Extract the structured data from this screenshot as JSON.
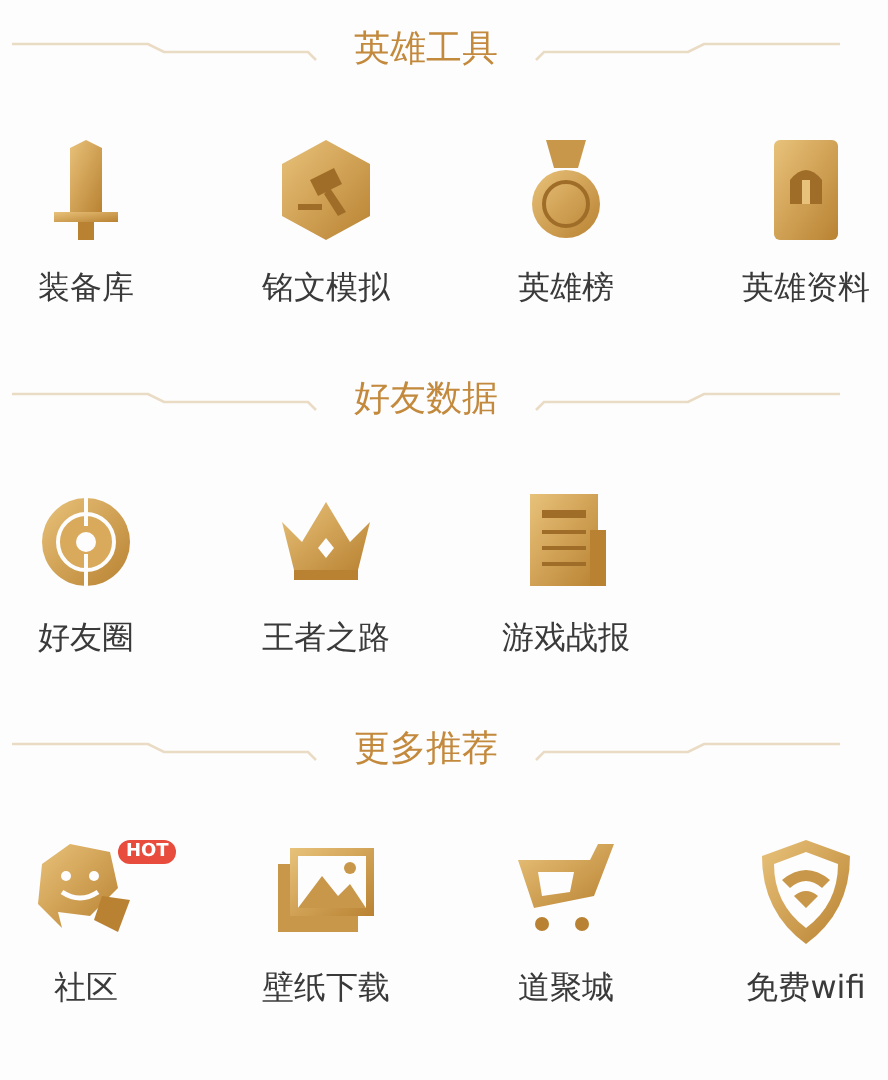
{
  "sections": [
    {
      "title": "英雄工具",
      "items": [
        {
          "label": "装备库"
        },
        {
          "label": "铭文模拟"
        },
        {
          "label": "英雄榜"
        },
        {
          "label": "英雄资料"
        }
      ]
    },
    {
      "title": "好友数据",
      "items": [
        {
          "label": "好友圈"
        },
        {
          "label": "王者之路"
        },
        {
          "label": "游戏战报"
        }
      ]
    },
    {
      "title": "更多推荐",
      "items": [
        {
          "label": "社区",
          "badge": "HOT"
        },
        {
          "label": "壁纸下载"
        },
        {
          "label": "道聚城"
        },
        {
          "label": "免费wifi"
        }
      ]
    }
  ]
}
